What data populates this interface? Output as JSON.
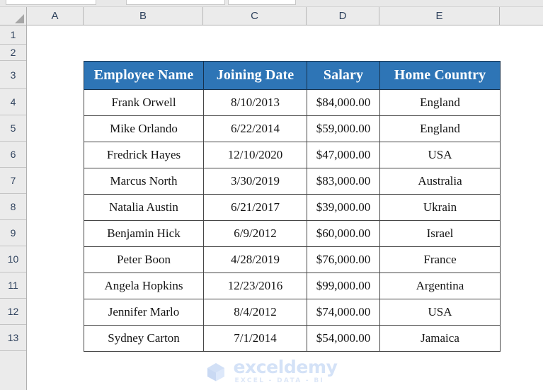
{
  "app": {
    "type": "spreadsheet",
    "accent_color": "#2E75B6",
    "header_text_color": "#FFFFFF",
    "sheet_background": "#FFFFFF",
    "gridline_color": "#EBEBEB"
  },
  "grid": {
    "column_headers": [
      "A",
      "B",
      "C",
      "D",
      "E"
    ],
    "row_headers": [
      "1",
      "2",
      "3",
      "4",
      "5",
      "6",
      "7",
      "8",
      "9",
      "10",
      "11",
      "12",
      "13"
    ],
    "select_all_corner": "select-all-triangle"
  },
  "table": {
    "range": "B3:E13",
    "headers": [
      "Employee Name",
      "Joining Date",
      "Salary",
      "Home Country"
    ],
    "rows": [
      {
        "name": "Frank Orwell",
        "date": "8/10/2013",
        "salary": "$84,000.00",
        "country": "England"
      },
      {
        "name": "Mike Orlando",
        "date": "6/22/2014",
        "salary": "$59,000.00",
        "country": "England"
      },
      {
        "name": "Fredrick Hayes",
        "date": "12/10/2020",
        "salary": "$47,000.00",
        "country": "USA"
      },
      {
        "name": "Marcus North",
        "date": "3/30/2019",
        "salary": "$83,000.00",
        "country": "Australia"
      },
      {
        "name": "Natalia Austin",
        "date": "6/21/2017",
        "salary": "$39,000.00",
        "country": "Ukrain"
      },
      {
        "name": "Benjamin Hick",
        "date": "6/9/2012",
        "salary": "$60,000.00",
        "country": "Israel"
      },
      {
        "name": "Peter Boon",
        "date": "4/28/2019",
        "salary": "$76,000.00",
        "country": "France"
      },
      {
        "name": "Angela Hopkins",
        "date": "12/23/2016",
        "salary": "$99,000.00",
        "country": "Argentina"
      },
      {
        "name": "Jennifer Marlo",
        "date": "8/4/2012",
        "salary": "$74,000.00",
        "country": "USA"
      },
      {
        "name": "Sydney Carton",
        "date": "7/1/2014",
        "salary": "$54,000.00",
        "country": "Jamaica"
      }
    ]
  },
  "watermark": {
    "logo_icon": "exceldemy-cube-logo",
    "name": "exceldemy",
    "tagline": "EXCEL - DATA - BI",
    "color": "#D4E2F7"
  }
}
